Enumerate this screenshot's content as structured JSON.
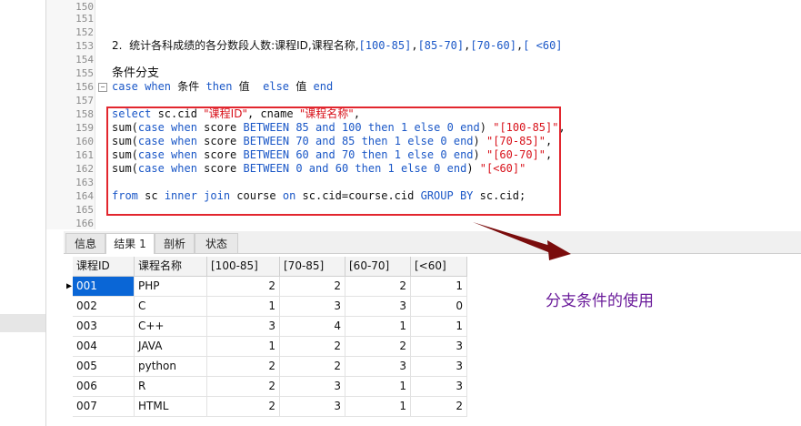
{
  "editor": {
    "lines": [
      {
        "n": "150",
        "t": ""
      },
      {
        "n": "151",
        "t": ""
      },
      {
        "n": "152",
        "t": ""
      },
      {
        "n": "153",
        "t": "2.  统计各科成绩的各分数段人数:课程ID,课程名称,[100-85],[85-70],[70-60],[ <60]"
      },
      {
        "n": "154",
        "t": ""
      },
      {
        "n": "155",
        "t": "条件分支"
      },
      {
        "n": "156",
        "t": "case when 条件 then 值  else 值 end"
      },
      {
        "n": "157",
        "t": ""
      },
      {
        "n": "158",
        "t": "select sc.cid \"课程ID\", cname \"课程名称\","
      },
      {
        "n": "159",
        "t": "sum(case when score BETWEEN 85 and 100 then 1 else 0 end) \"[100-85]\","
      },
      {
        "n": "160",
        "t": "sum(case when score BETWEEN 70 and 85 then 1 else 0 end) \"[70-85]\","
      },
      {
        "n": "161",
        "t": "sum(case when score BETWEEN 60 and 70 then 1 else 0 end) \"[60-70]\","
      },
      {
        "n": "162",
        "t": "sum(case when score BETWEEN 0 and 60 then 1 else 0 end) \"[<60]\""
      },
      {
        "n": "163",
        "t": ""
      },
      {
        "n": "164",
        "t": "from sc inner join course on sc.cid=course.cid GROUP BY sc.cid;"
      },
      {
        "n": "165",
        "t": ""
      },
      {
        "n": "166",
        "t": ""
      }
    ]
  },
  "tabs": [
    {
      "label": "信息"
    },
    {
      "label": "结果 1"
    },
    {
      "label": "剖析"
    },
    {
      "label": "状态"
    }
  ],
  "result": {
    "columns": [
      "课程ID",
      "课程名称",
      "[100-85]",
      "[70-85]",
      "[60-70]",
      "[<60]"
    ],
    "rows": [
      [
        "001",
        "PHP",
        "2",
        "2",
        "2",
        "1"
      ],
      [
        "002",
        "C",
        "1",
        "3",
        "3",
        "0"
      ],
      [
        "003",
        "C++",
        "3",
        "4",
        "1",
        "1"
      ],
      [
        "004",
        "JAVA",
        "1",
        "2",
        "2",
        "3"
      ],
      [
        "005",
        "python",
        "2",
        "2",
        "3",
        "3"
      ],
      [
        "006",
        "R",
        "2",
        "3",
        "1",
        "3"
      ],
      [
        "007",
        "HTML",
        "2",
        "3",
        "1",
        "2"
      ]
    ],
    "row_indicator": "▶"
  },
  "annotation": {
    "caption": "分支条件的使用",
    "box_color": "#e2262e",
    "arrow_color": "#7a0c0c"
  }
}
